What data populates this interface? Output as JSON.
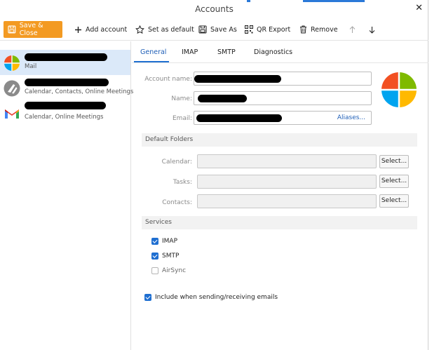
{
  "window": {
    "title": "Accounts"
  },
  "toolbar": {
    "save_close": "Save & Close",
    "add_account": "Add account",
    "set_default": "Set as default",
    "save_as": "Save As",
    "qr_export": "QR Export",
    "remove": "Remove"
  },
  "accounts": [
    {
      "subtitle": "Mail",
      "icon": "microsoft-logo-icon"
    },
    {
      "subtitle": "Calendar, Contacts, Online Meetings",
      "icon": "person-icon"
    },
    {
      "subtitle": "Calendar, Online Meetings",
      "icon": "gmail-logo-icon"
    }
  ],
  "tabs": [
    "General",
    "IMAP",
    "SMTP",
    "Diagnostics"
  ],
  "general": {
    "account_name_label": "Account name:",
    "name_label": "Name:",
    "email_label": "Email:",
    "aliases": "Aliases..."
  },
  "default_folders": {
    "header": "Default Folders",
    "calendar_label": "Calendar:",
    "tasks_label": "Tasks:",
    "contacts_label": "Contacts:",
    "select_label": "Select..."
  },
  "services": {
    "header": "Services",
    "imap": {
      "label": "IMAP",
      "checked": true
    },
    "smtp": {
      "label": "SMTP",
      "checked": true
    },
    "airsync": {
      "label": "AirSync",
      "checked": false
    }
  },
  "include_sending": {
    "label": "Include when sending/receiving emails",
    "checked": true
  },
  "colors": {
    "accent": "#1f6fd1",
    "save_button": "#f39a22",
    "selected_row": "#dbe9f9"
  }
}
